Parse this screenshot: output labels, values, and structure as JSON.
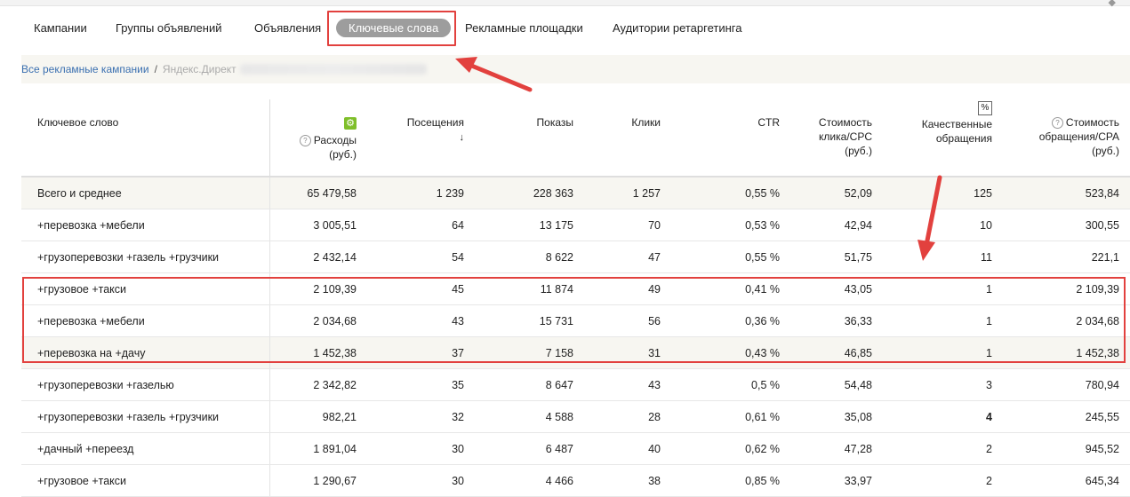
{
  "tabs": [
    {
      "label": "Кампании",
      "active": false
    },
    {
      "label": "Группы объявлений",
      "active": false
    },
    {
      "label": "Объявления",
      "active": false
    },
    {
      "label": "Ключевые слова",
      "active": true
    },
    {
      "label": "Рекламные площадки",
      "active": false
    },
    {
      "label": "Аудитории ретаргетинга",
      "active": false
    }
  ],
  "breadcrumb": {
    "link": "Все рекламные кампании",
    "separator": "/",
    "current": "Яндекс.Директ"
  },
  "table": {
    "headers": {
      "keyword": "Ключевое слово",
      "spend_line1": "Расходы",
      "spend_line2": "(руб.)",
      "visits": "Посещения",
      "impressions": "Показы",
      "clicks": "Клики",
      "ctr": "CTR",
      "cpc_line1": "Стоимость",
      "cpc_line2": "клика/CPC",
      "cpc_line3": "(руб.)",
      "conv_line1": "Качественные",
      "conv_line2": "обращения",
      "cpa_line1": "Стоимость",
      "cpa_line2": "обращения/CPA",
      "cpa_line3": "(руб.)",
      "percent_icon_label": "%",
      "help_icon_label": "?",
      "sort_arrow": "↓"
    },
    "rows": [
      {
        "kw": "Всего и среднее",
        "spend": "65 479,58",
        "visits": "1 239",
        "impr": "228 363",
        "clicks": "1 257",
        "ctr": "0,55 %",
        "cpc": "52,09",
        "conv": "125",
        "cpa": "523,84"
      },
      {
        "kw": "+перевозка +мебели",
        "spend": "3 005,51",
        "visits": "64",
        "impr": "13 175",
        "clicks": "70",
        "ctr": "0,53 %",
        "cpc": "42,94",
        "conv": "10",
        "cpa": "300,55"
      },
      {
        "kw": "+грузоперевозки +газель +грузчики",
        "spend": "2 432,14",
        "visits": "54",
        "impr": "8 622",
        "clicks": "47",
        "ctr": "0,55 %",
        "cpc": "51,75",
        "conv": "11",
        "cpa": "221,1"
      },
      {
        "kw": "+грузовое +такси",
        "spend": "2 109,39",
        "visits": "45",
        "impr": "11 874",
        "clicks": "49",
        "ctr": "0,41 %",
        "cpc": "43,05",
        "conv": "1",
        "cpa": "2 109,39"
      },
      {
        "kw": "+перевозка +мебели",
        "spend": "2 034,68",
        "visits": "43",
        "impr": "15 731",
        "clicks": "56",
        "ctr": "0,36 %",
        "cpc": "36,33",
        "conv": "1",
        "cpa": "2 034,68"
      },
      {
        "kw": "+перевозка на +дачу",
        "spend": "1 452,38",
        "visits": "37",
        "impr": "7 158",
        "clicks": "31",
        "ctr": "0,43 %",
        "cpc": "46,85",
        "conv": "1",
        "cpa": "1 452,38"
      },
      {
        "kw": "+грузоперевозки +газелью",
        "spend": "2 342,82",
        "visits": "35",
        "impr": "8 647",
        "clicks": "43",
        "ctr": "0,5 %",
        "cpc": "54,48",
        "conv": "3",
        "cpa": "780,94"
      },
      {
        "kw": "+грузоперевозки +газель +грузчики",
        "spend": "982,21",
        "visits": "32",
        "impr": "4 588",
        "clicks": "28",
        "ctr": "0,61 %",
        "cpc": "35,08",
        "conv": "4",
        "cpa": "245,55"
      },
      {
        "kw": "+дачный +переезд",
        "spend": "1 891,04",
        "visits": "30",
        "impr": "6 487",
        "clicks": "40",
        "ctr": "0,62 %",
        "cpc": "47,28",
        "conv": "2",
        "cpa": "945,52"
      },
      {
        "kw": "+грузовое +такси",
        "spend": "1 290,67",
        "visits": "30",
        "impr": "4 466",
        "clicks": "38",
        "ctr": "0,85 %",
        "cpc": "33,97",
        "conv": "2",
        "cpa": "645,34"
      }
    ]
  },
  "colors": {
    "annotation_red": "#e2413e",
    "accent_green": "#7fbf2a",
    "active_tab_bg": "#9d9d9d"
  }
}
